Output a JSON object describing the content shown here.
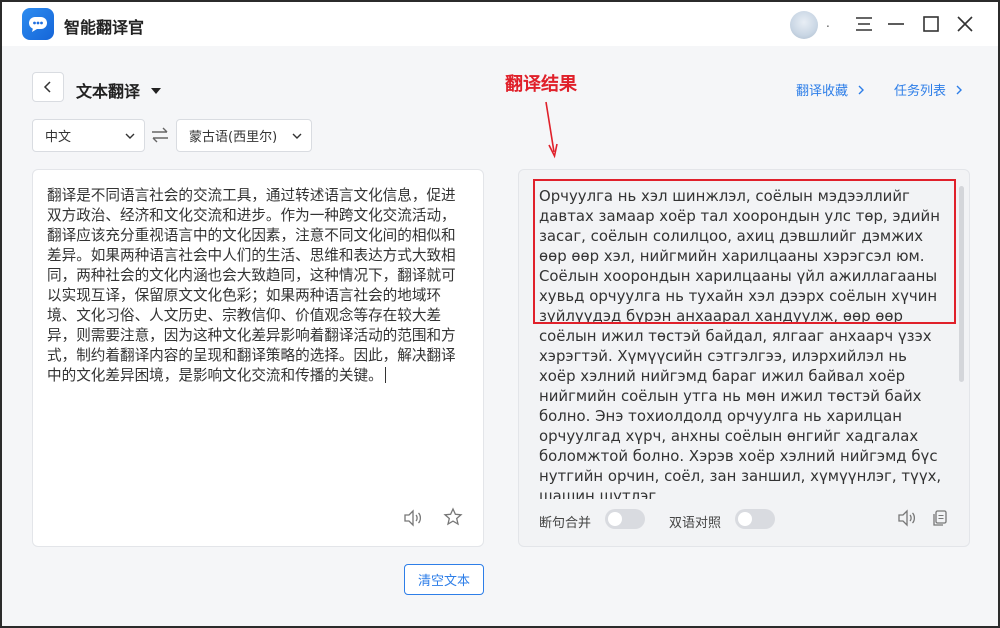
{
  "app": {
    "title": "智能翻译官",
    "avatar_suffix": "."
  },
  "header": {
    "mode_title": "文本翻译",
    "annotation": "翻译结果",
    "favorites_link": "翻译收藏",
    "tasks_link": "任务列表"
  },
  "languages": {
    "source": "中文",
    "target": "蒙古语(西里尔)"
  },
  "source": {
    "text": "翻译是不同语言社会的交流工具，通过转述语言文化信息，促进双方政治、经济和文化交流和进步。作为一种跨文化交流活动，翻译应该充分重视语言中的文化因素，注意不同文化间的相似和差异。如果两种语言社会中人们的生活、思维和表达方式大致相同，两种社会的文化内涵也会大致趋同，这种情况下，翻译就可以实现互译，保留原文文化色彩；如果两种语言社会的地域环境、文化习俗、人文历史、宗教信仰、价值观念等存在较大差异，则需要注意，因为这种文化差异影响着翻译活动的范围和方式，制约着翻译内容的呈现和翻译策略的选择。因此，解决翻译中的文化差异困境，是影响文化交流和传播的关键。"
  },
  "target": {
    "text": "Орчуулга нь хэл шинжлэл, соёлын мэдээллийг давтах замаар хоёр тал хоорондын улс төр, эдийн засаг, соёлын солилцоо, ахиц дэвшлийг дэмжих өөр өөр хэл, нийгмийн харилцааны хэрэгсэл юм. Соёлын хоорондын харилцааны үйл ажиллагааны хувьд орчуулга нь тухайн хэл дээрх соёлын хүчин зүйлүүдэд бүрэн анхаарал хандуулж, өөр өөр соёлын ижил төстэй байдал, ялгааг анхаарч үзэх хэрэгтэй. Хүмүүсийн сэтгэлгээ, илэрхийлэл нь хоёр хэлний нийгэмд бараг ижил байвал хоёр нийгмийн соёлын утга нь мөн ижил төстэй байх болно. Энэ тохиолдолд орчуулга нь харилцан орчуулгад хүрч, анхны соёлын өнгийг хадгалах боломжтой болно. Хэрэв хоёр хэлний нийгэмд бүс нутгийн орчин, соёл, зан заншил, хүмүүнлэг, түүх, шашин шүтлэг"
  },
  "toggles": {
    "sentence_merge": "断句合并",
    "bilingual": "双语对照"
  },
  "actions": {
    "clear": "清空文本"
  },
  "colors": {
    "accent": "#2d7ee8",
    "annotation": "#e0202a"
  },
  "icons": {
    "logo": "chat-bubble-icon",
    "source_speaker": "speaker-icon",
    "source_favorite": "star-icon",
    "target_speaker": "speaker-icon",
    "target_copy": "copy-icon"
  }
}
